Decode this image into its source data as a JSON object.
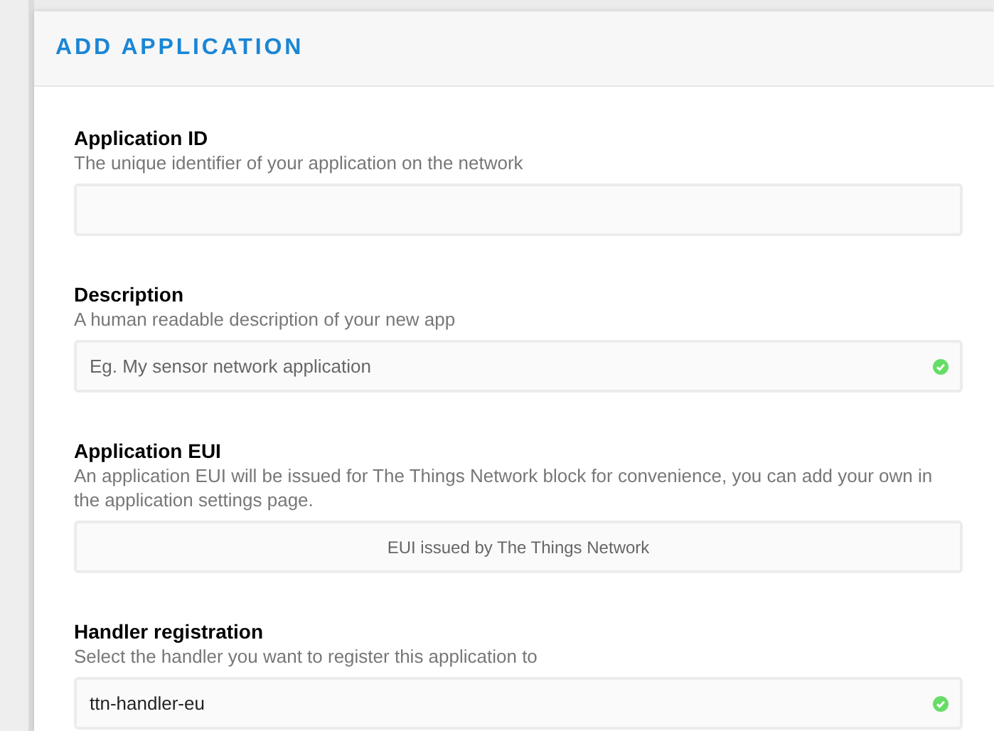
{
  "title": "ADD APPLICATION",
  "fields": [
    {
      "label": "Application ID",
      "description": "The unique identifier of your application on the network",
      "kind": "input",
      "valid": false
    },
    {
      "label": "Description",
      "description": "A human readable description of your new app",
      "kind": "input",
      "placeholder": "Eg. My sensor network application",
      "valid": true
    },
    {
      "label": "Application EUI",
      "description": "An application EUI will be issued for The Things Network block for convenience, you can add your own in the application settings page.",
      "kind": "readonly",
      "placeholder": "EUI issued by The Things Network",
      "valid": false
    },
    {
      "label": "Handler registration",
      "description": "Select the handler you want to register this application to",
      "kind": "input",
      "value": "ttn-handler-eu",
      "valid": true
    }
  ]
}
